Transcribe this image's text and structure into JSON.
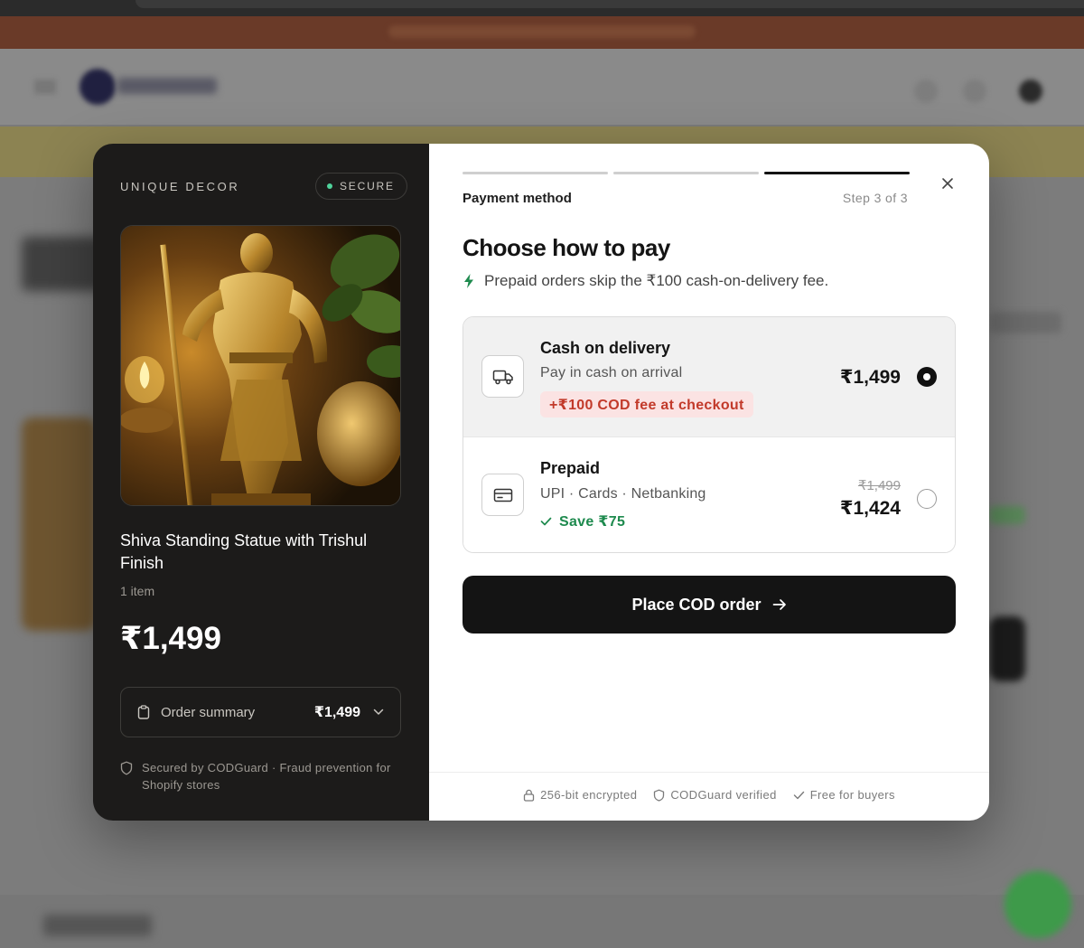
{
  "store": {
    "brand": "UNIQUE DECOR",
    "secure_badge": "SECURE",
    "product_name": "Shiva Standing Statue with Trishul Finish",
    "item_count": "1 item",
    "price": "₹1,499",
    "order_summary_label": "Order summary",
    "order_summary_price": "₹1,499",
    "secured_by": "Secured by CODGuard · Fraud prevention for Shopify stores"
  },
  "checkout": {
    "step_label": "Payment method",
    "step_count": "Step 3 of 3",
    "progress": {
      "current": 3,
      "total": 3
    },
    "heading": "Choose how to pay",
    "promo": "Prepaid orders skip the ₹100 cash-on-delivery fee.",
    "options": [
      {
        "title": "Cash on delivery",
        "subtitle": "Pay in cash on arrival",
        "badge": "+₹100 COD fee at checkout",
        "price": "₹1,499",
        "selected": true,
        "icon": "truck-icon"
      },
      {
        "title": "Prepaid",
        "subtitle": "UPI · Cards · Netbanking",
        "saving": "Save ₹75",
        "old_price": "₹1,499",
        "price": "₹1,424",
        "selected": false,
        "icon": "credit-card-icon"
      }
    ],
    "cta_label": "Place COD order",
    "trust": [
      "256-bit encrypted",
      "CODGuard verified",
      "Free for buyers"
    ]
  },
  "colors": {
    "left_panel_bg": "#1c1b1a",
    "accent_dark": "#141414",
    "fee_red": "#c23a2a",
    "fee_bg": "#fbe3e3",
    "save_green": "#1e8a4e",
    "secure_dot": "#4fd39b"
  }
}
